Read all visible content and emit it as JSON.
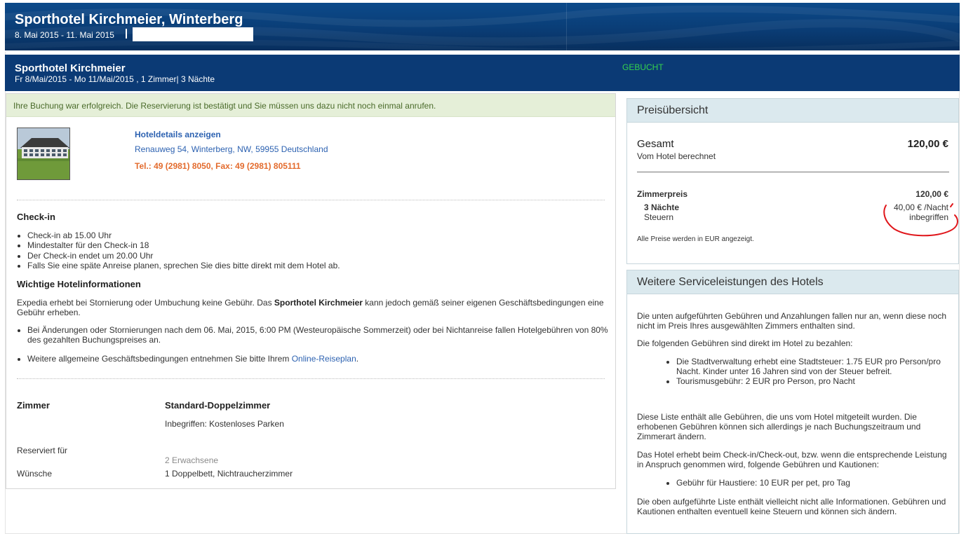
{
  "banner": {
    "title": "Sporthotel Kirchmeier, Winterberg",
    "dates": "8. Mai 2015 - 11. Mai 2015"
  },
  "booking_header": {
    "title": "Sporthotel Kirchmeier",
    "info": "Fr 8/Mai/2015 - Mo 11/Mai/2015 , 1 Zimmer| 3 Nächte",
    "status": "GEBUCHT"
  },
  "confirmation": "Ihre Buchung war erfolgreich. Die Reservierung ist bestätigt und Sie müssen uns dazu nicht noch einmal anrufen.",
  "hotel": {
    "details_link": "Hoteldetails anzeigen",
    "address": "Renauweg 54, Winterberg, NW, 59955 Deutschland",
    "phone": "Tel.: 49 (2981) 8050, Fax: 49 (2981) 805111"
  },
  "checkin": {
    "heading": "Check-in",
    "items": [
      "Check-in ab 15.00 Uhr",
      "Mindestalter für den Check-in 18",
      "Der Check-in endet um 20.00 Uhr",
      "Falls Sie eine späte Anreise planen, sprechen Sie dies bitte direkt mit dem Hotel ab."
    ]
  },
  "info": {
    "heading": "Wichtige Hotelinformationen",
    "intro_before": "Expedia erhebt bei Stornierung oder Umbuchung keine Gebühr. Das ",
    "intro_bold": "Sporthotel Kirchmeier",
    "intro_after": " kann jedoch gemäß seiner eigenen Geschäftsbedingungen eine Gebühr erheben.",
    "bullet1": "Bei Änderungen oder Stornierungen nach dem 06. Mai, 2015, 6:00 PM (Westeuropäische Sommerzeit) oder bei Nichtanreise fallen Hotelgebühren von 80% des gezahlten Buchungspreises an.",
    "bullet2_before": "Weitere allgemeine Geschäftsbedingungen entnehmen Sie bitte Ihrem ",
    "bullet2_link": "Online-Reiseplan",
    "bullet2_after": "."
  },
  "room": {
    "label": "Zimmer",
    "type": "Standard-Doppelzimmer",
    "included": "Inbegriffen: Kostenloses Parken",
    "reserved_label": "Reserviert für",
    "guests": "2 Erwachsene",
    "wishes_label": "Wünsche",
    "wishes": "1 Doppelbett, Nichtraucherzimmer"
  },
  "price_overview": {
    "heading": "Preisübersicht",
    "total_label": "Gesamt",
    "total_value": "120,00 €",
    "charged_by": "Vom Hotel berechnet",
    "room_price_label": "Zimmerpreis",
    "room_price_value": "120,00 €",
    "nights_label": "3 Nächte",
    "per_night": "40,00 € /Nacht",
    "taxes_label": "Steuern",
    "taxes_value": "inbegriffen",
    "currency_note": "Alle Preise werden in EUR angezeigt."
  },
  "services": {
    "heading": "Weitere Serviceleistungen des Hotels",
    "p1": "Die unten aufgeführten Gebühren und Anzahlungen fallen nur an, wenn diese noch nicht im Preis Ihres ausgewählten Zimmers enthalten sind.",
    "p2": "Die folgenden Gebühren sind direkt im Hotel zu bezahlen:",
    "fees": [
      "Die Stadtverwaltung erhebt eine Stadtsteuer: 1.75 EUR pro Person/pro Nacht. Kinder unter 16 Jahren sind von der Steuer befreit.",
      "Tourismusgebühr: 2 EUR pro Person, pro Nacht"
    ],
    "p3": "Diese Liste enthält alle Gebühren, die uns vom Hotel mitgeteilt wurden. Die erhobenen Gebühren können sich allerdings je nach Buchungszeitraum und Zimmerart ändern.",
    "p4": "Das Hotel erhebt beim Check-in/Check-out, bzw. wenn die entsprechende Leistung in Anspruch genommen wird, folgende Gebühren und Kautionen:",
    "deposits": [
      "Gebühr für Haustiere: 10 EUR per pet, pro Tag"
    ],
    "p5": "Die oben aufgeführte Liste enthält vielleicht nicht alle Informationen. Gebühren und Kautionen enthalten eventuell keine Steuern und können sich ändern."
  }
}
